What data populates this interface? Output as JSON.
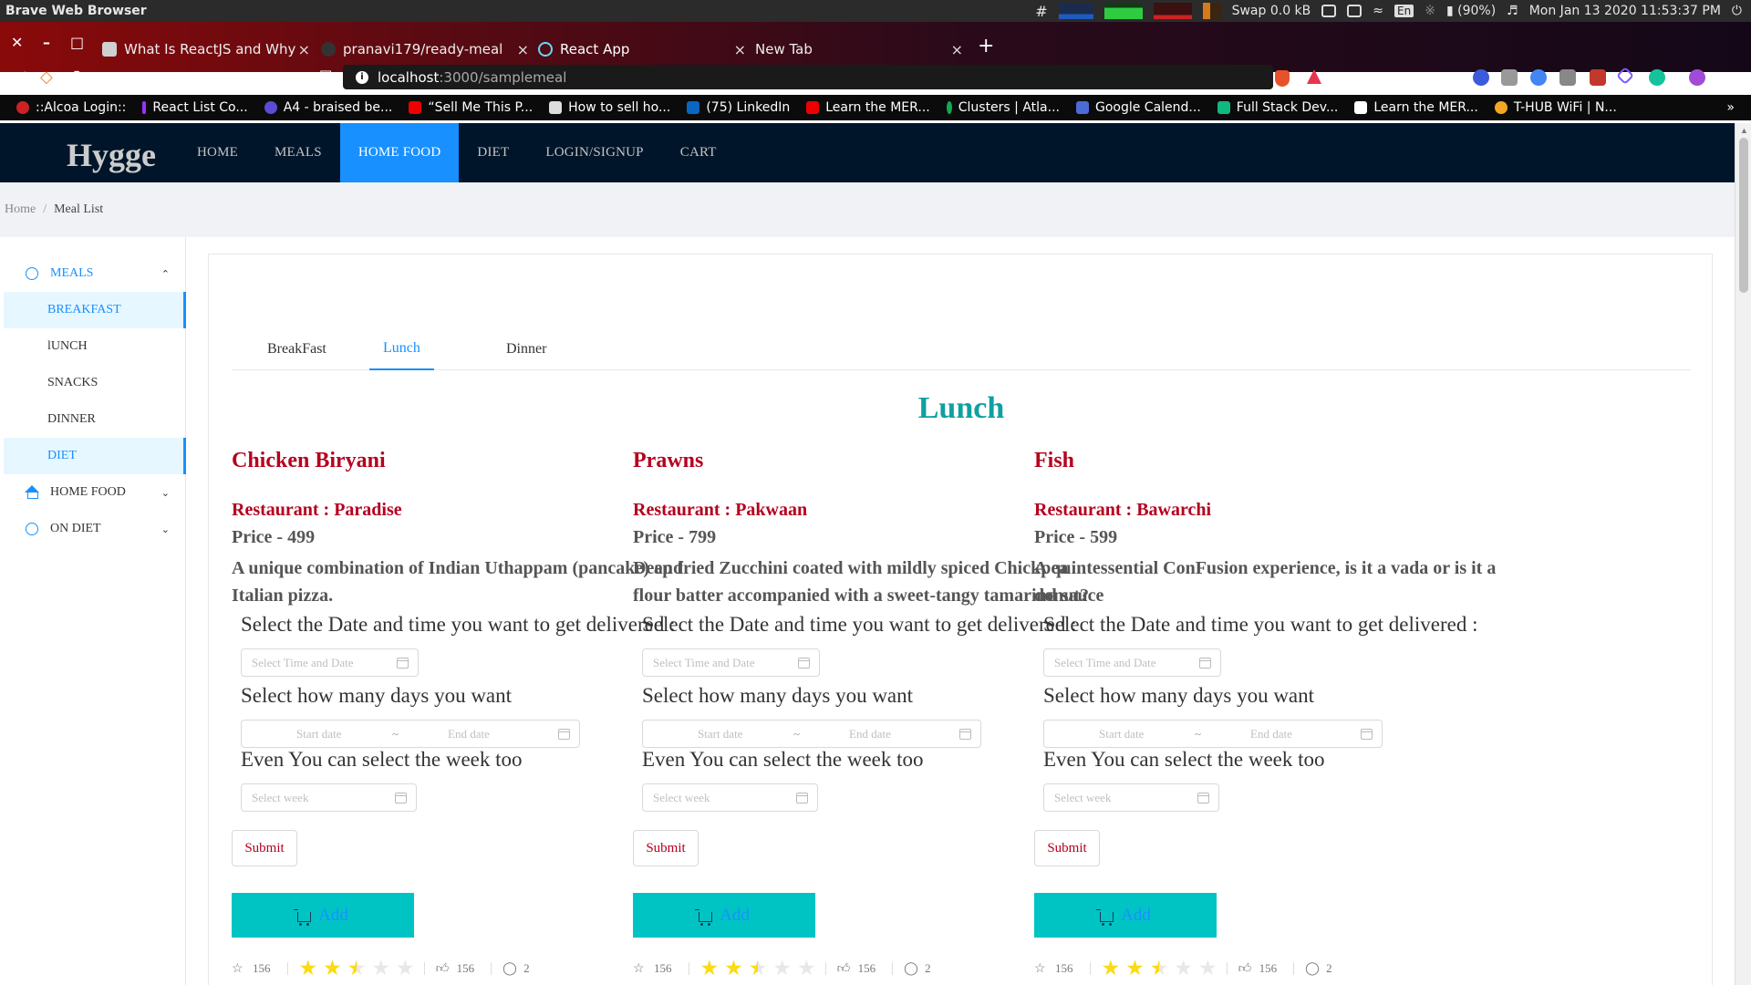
{
  "os": {
    "title": "Brave Web Browser",
    "swap": "Swap 0.0 kB",
    "lang": "En",
    "battery": "(90%)",
    "clock": "Mon Jan 13 2020 11:53:37 PM"
  },
  "browser": {
    "tabs": [
      {
        "label": "What Is ReactJS and Why S",
        "active": false
      },
      {
        "label": "pranavi179/ready-meal",
        "active": false
      },
      {
        "label": "React App",
        "active": true
      },
      {
        "label": "New Tab",
        "active": false
      }
    ],
    "url_host": "localhost",
    "url_path": ":3000/samplemeal",
    "bookmarks": [
      "::Alcoa Login::",
      "React List Co...",
      "A4 - braised be...",
      "“Sell Me This P...",
      "How to sell ho...",
      "(75) LinkedIn",
      "Learn the MER...",
      "Clusters | Atla...",
      "Google Calend...",
      "Full Stack Dev...",
      "Learn the MER...",
      "T-HUB WiFi | N..."
    ],
    "bookmarks_more": "»"
  },
  "app": {
    "brand": "Hygge",
    "nav": [
      {
        "label": "HOME",
        "active": false
      },
      {
        "label": "MEALS",
        "active": false
      },
      {
        "label": "HOME FOOD",
        "active": true
      },
      {
        "label": "DIET",
        "active": false
      },
      {
        "label": "LOGIN/SIGNUP",
        "active": false
      },
      {
        "label": "CART",
        "active": false
      }
    ],
    "breadcrumb": {
      "home": "Home",
      "sep": "/",
      "current": "Meal List"
    },
    "sidebar": {
      "meals_label": "MEALS",
      "items": [
        "BREAKFAST",
        "lUNCH",
        "SNACKS",
        "DINNER",
        "DIET"
      ],
      "home_food_label": "HOME FOOD",
      "on_diet_label": "ON DIET"
    },
    "tabs": [
      "BreakFast",
      "Lunch",
      "Dinner"
    ],
    "active_tab": "Lunch",
    "section_title": "Lunch",
    "form": {
      "q_date": "Select the Date and time you want to get delivered :",
      "date_placeholder": "Select Time and Date",
      "q_days": "Select how many days you want",
      "start_placeholder": "Start date",
      "range_sep": "~",
      "end_placeholder": "End date",
      "q_week": "Even You can select the week too",
      "week_placeholder": "Select week",
      "submit": "Submit",
      "add": "Add"
    },
    "meals": [
      {
        "name": "Chicken Biryani",
        "restaurant": "Restaurant : Paradise",
        "price": "Price - 499",
        "description": "A unique combination of Indian Uthappam (pancake) and Italian pizza.",
        "stars": "156",
        "rating": 2.5,
        "likes": "156",
        "comments": "2"
      },
      {
        "name": "Prawns",
        "restaurant": "Restaurant : Pakwaan",
        "price": "Price - 799",
        "description": "Deep fried Zucchini coated with mildly spiced Chickpea flour batter accompanied with a sweet-tangy tamarind sauce",
        "stars": "156",
        "rating": 2.5,
        "likes": "156",
        "comments": "2"
      },
      {
        "name": "Fish",
        "restaurant": "Restaurant : Bawarchi",
        "price": "Price - 599",
        "description": "A quintessential ConFusion experience, is it a vada or is it a donut?",
        "stars": "156",
        "rating": 2.5,
        "likes": "156",
        "comments": "2"
      }
    ]
  },
  "colors": {
    "nav_bg": "#001529",
    "accent": "#1890ff",
    "dish_red": "#b5001e",
    "title_teal": "#0fa0a0",
    "add_btn": "#00c4c4"
  }
}
